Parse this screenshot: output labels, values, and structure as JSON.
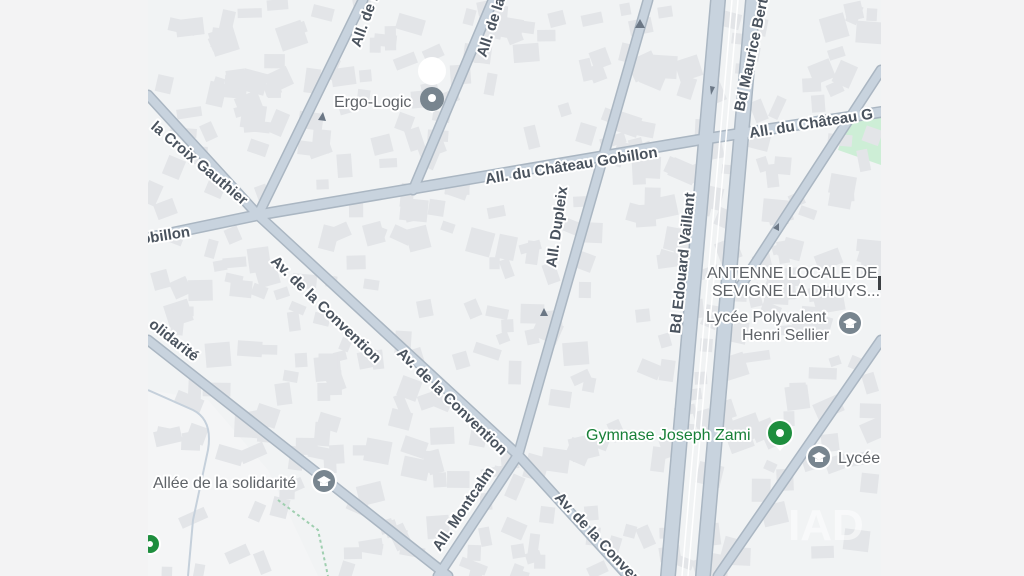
{
  "map": {
    "streets": [
      "All. de la",
      "All. de la",
      "la Croix Gauthier",
      "All. du Château Gobillon",
      "All. du Château G",
      "obillon",
      "Bd Maurice Berte",
      "All. Dupleix",
      "Bd Edouard Vaillant",
      "Av. de la Convention",
      "Av. de la Convention",
      "olidarité",
      "All. Montcalm",
      "Av. de la Conven"
    ],
    "places": {
      "ergo": "Ergo-Logic",
      "antenne_line1": "ANTENNE LOCALE DE",
      "antenne_line2": "SEVIGNE LA DHUYS...",
      "lycee_poly_line1": "Lycée Polyvalent",
      "lycee_poly_line2": "Henri Sellier",
      "gymnase": "Gymnase Joseph Zami",
      "lycee": "Lycée",
      "allee_solidarite": "Allée de la solidarité"
    },
    "icons": {
      "ergo": "map-pin-icon",
      "lycee_poly": "school-icon",
      "gymnase": "sports-pin-icon",
      "lycee": "school-icon",
      "allee_solidarite": "school-icon",
      "edge_poi": "green-pin-icon"
    },
    "watermark": "IAD",
    "colors": {
      "background": "#f1f3f4",
      "road": "#c5d0db",
      "road_edge": "#aab6c2",
      "building": "#e3e5e8",
      "label": "#4a535e",
      "poi_gray": "#5f6368",
      "poi_green": "#188038",
      "park": "#cdeed6"
    }
  }
}
